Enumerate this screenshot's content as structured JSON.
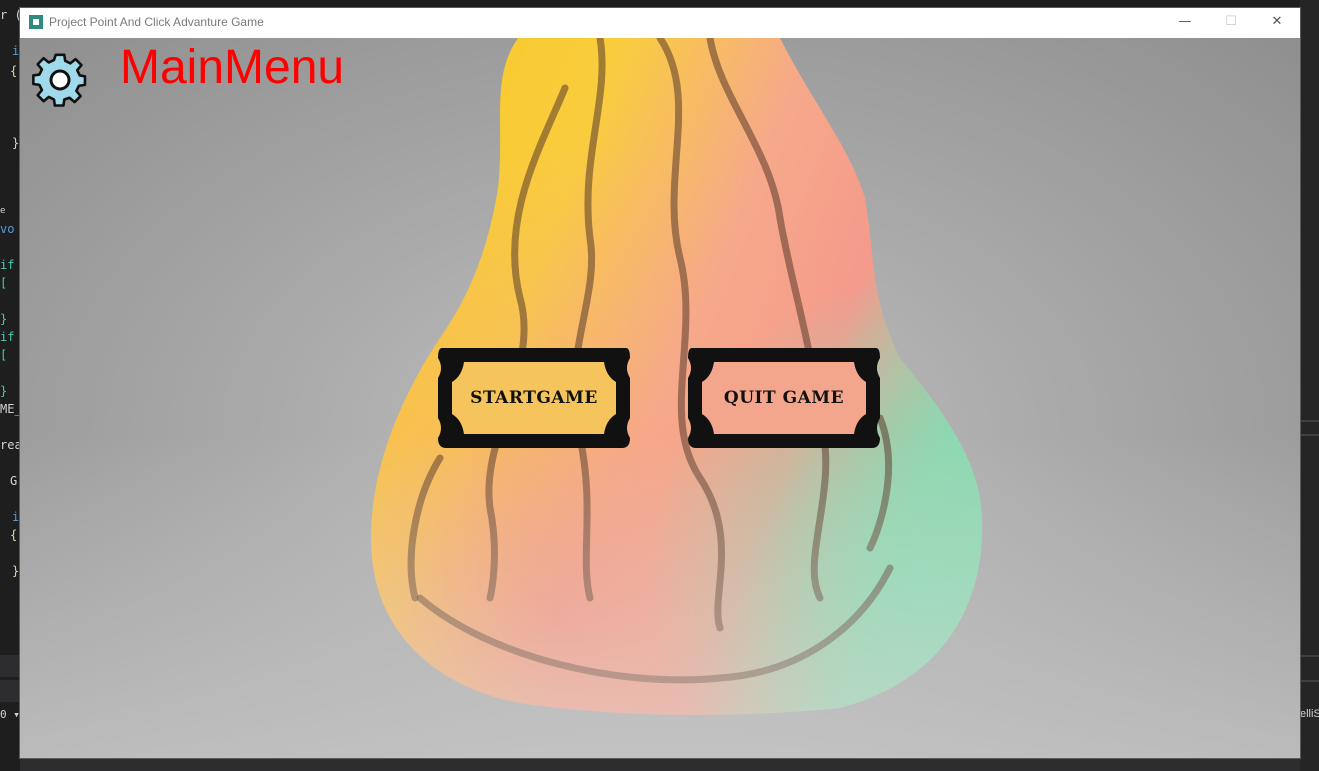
{
  "window": {
    "title": "Project Point And Click Advanture Game",
    "controls": {
      "minimize": "—",
      "maximize": "☐",
      "close": "✕"
    }
  },
  "menu": {
    "title": "MainMenu",
    "title_color": "#ff0000",
    "settings_icon": "gear-icon",
    "buttons": {
      "start": "STARTGAME",
      "quit": "QUIT GAME"
    }
  },
  "background_ide": {
    "left_lines": [
      "r (",
      "i",
      "{",
      "}",
      "e",
      " vo",
      "if",
      "[",
      "}",
      "if",
      "[",
      "}",
      "ME_",
      "rea",
      "G",
      "i",
      "{",
      "}",
      "0 ▾"
    ],
    "right_text": "elliS"
  }
}
